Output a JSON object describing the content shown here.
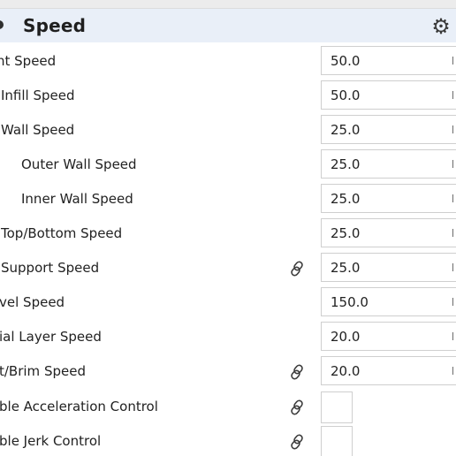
{
  "section": {
    "title": "Speed",
    "settings_icon": "gear-icon",
    "collapse_icon": "section-collapse-icon"
  },
  "rows": [
    {
      "label": "nt Speed",
      "value": "50.0",
      "kind": "number",
      "linked": false
    },
    {
      "label": "Infill Speed",
      "value": "50.0",
      "kind": "number",
      "linked": false
    },
    {
      "label": "Wall Speed",
      "value": "25.0",
      "kind": "number",
      "linked": false
    },
    {
      "label": "Outer Wall Speed",
      "value": "25.0",
      "kind": "number",
      "linked": false
    },
    {
      "label": "Inner Wall Speed",
      "value": "25.0",
      "kind": "number",
      "linked": false
    },
    {
      "label": "Top/Bottom Speed",
      "value": "25.0",
      "kind": "number",
      "linked": false
    },
    {
      "label": "Support Speed",
      "value": "25.0",
      "kind": "number",
      "linked": true
    },
    {
      "label": "vel Speed",
      "value": "150.0",
      "kind": "number",
      "linked": false
    },
    {
      "label": "ial Layer Speed",
      "value": "20.0",
      "kind": "number",
      "linked": false
    },
    {
      "label": "t/Brim Speed",
      "value": "20.0",
      "kind": "number",
      "linked": true
    },
    {
      "label": "ble Acceleration Control",
      "value": "",
      "kind": "checkbox",
      "linked": true
    },
    {
      "label": "ble Jerk Control",
      "value": "",
      "kind": "checkbox",
      "linked": true
    }
  ],
  "colors": {
    "header_bg": "#e9eff8",
    "field_border": "#cfcfcf",
    "text": "#222222"
  },
  "icons": {
    "link": "link-chain-icon",
    "settings": "gear-icon"
  }
}
